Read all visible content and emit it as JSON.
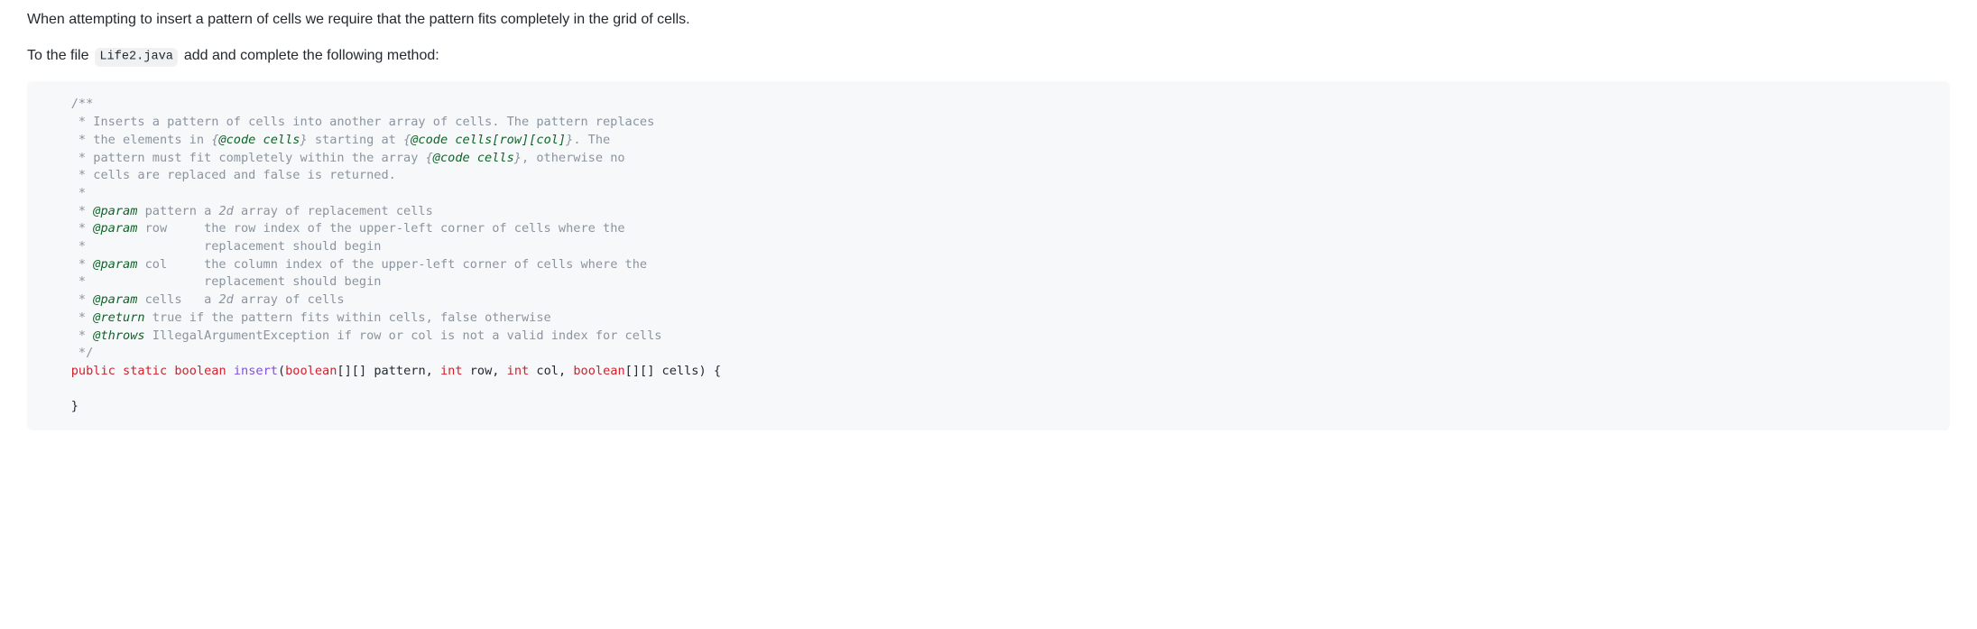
{
  "para1": "When attempting to insert a pattern of cells we require that the pattern fits completely in the grid of cells.",
  "para2_prefix": "To the file ",
  "para2_code": "Life2.java",
  "para2_suffix": " add and complete the following method:",
  "code": {
    "l01": "    /**",
    "l02": "     * Inserts a pattern of cells into another array of cells. The pattern replaces",
    "l03_a": "     * the elements in ",
    "l03_b": "{",
    "l03_c": "@code cells",
    "l03_d": "}",
    "l03_e": " starting at ",
    "l03_f": "{",
    "l03_g": "@code cells[row][col]",
    "l03_h": "}",
    "l03_i": ". The",
    "l04_a": "     * pattern must fit completely within the array ",
    "l04_b": "{",
    "l04_c": "@code cells",
    "l04_d": "}",
    "l04_e": ", otherwise no",
    "l05": "     * cells are replaced and false is returned.",
    "l06": "     * ",
    "l07_a": "     * ",
    "l07_b": "@param",
    "l07_c": " pattern a ",
    "l07_d": "2d",
    "l07_e": " array of replacement cells",
    "l08_a": "     * ",
    "l08_b": "@param",
    "l08_c": " row     the row index of the upper-left corner of cells where the",
    "l09": "     *                replacement should begin",
    "l10_a": "     * ",
    "l10_b": "@param",
    "l10_c": " col     the column index of the upper-left corner of cells where the",
    "l11": "     *                replacement should begin",
    "l12_a": "     * ",
    "l12_b": "@param",
    "l12_c": " cells   a ",
    "l12_d": "2d",
    "l12_e": " array of cells",
    "l13_a": "     * ",
    "l13_b": "@return",
    "l13_c": " true if the pattern fits within cells, false otherwise",
    "l14_a": "     * ",
    "l14_b": "@throws",
    "l14_c": " IllegalArgumentException if row or col is not a valid index for cells",
    "l15": "     */",
    "l16_a": "    ",
    "l16_public": "public",
    "l16_sp1": " ",
    "l16_static": "static",
    "l16_sp2": " ",
    "l16_boolean": "boolean",
    "l16_sp3": " ",
    "l16_fn": "insert",
    "l16_open": "(",
    "l16_t1": "boolean",
    "l16_arr1": "[][] pattern, ",
    "l16_t2": "int",
    "l16_p2": " row, ",
    "l16_t3": "int",
    "l16_p3": " col, ",
    "l16_t4": "boolean",
    "l16_arr2": "[][] cells",
    "l16_close": ")",
    "l16_brace": " {",
    "l17": "",
    "l18": "    }"
  }
}
